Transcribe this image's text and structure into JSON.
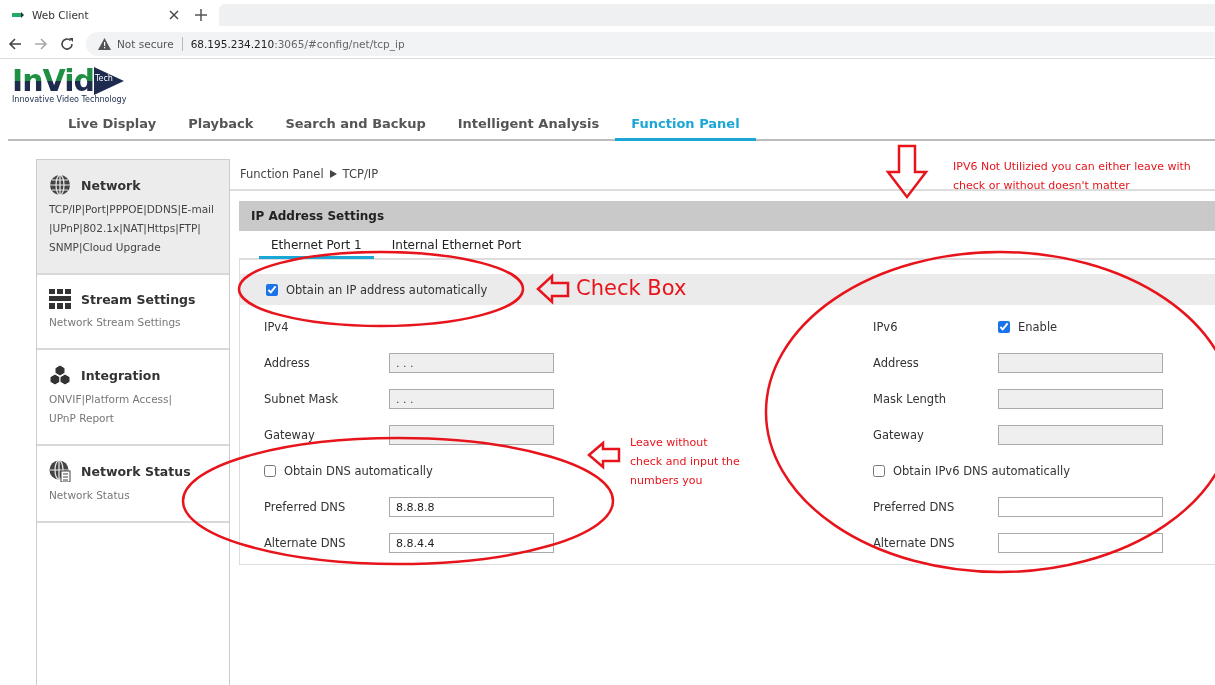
{
  "browser": {
    "tab_title": "Web Client",
    "warning": "Not secure",
    "host": "68.195.234.210",
    "path": ":3065/#config/net/tcp_ip"
  },
  "logo": {
    "name": "InVid",
    "badge": "Tech",
    "tagline": "Innovative Video Technology"
  },
  "nav": [
    {
      "label": "Live Display",
      "selected": false
    },
    {
      "label": "Playback",
      "selected": false
    },
    {
      "label": "Search and Backup",
      "selected": false
    },
    {
      "label": "Intelligent Analysis",
      "selected": false
    },
    {
      "label": "Function Panel",
      "selected": true
    }
  ],
  "sidebar": [
    {
      "title": "Network",
      "lines": [
        "TCP/IP|Port|PPPOE|DDNS|E-mail",
        "|UPnP|802.1x|NAT|Https|FTP|",
        "SNMP|Cloud Upgrade"
      ],
      "selected": true
    },
    {
      "title": "Stream Settings",
      "lines": [
        "Network Stream Settings"
      ],
      "selected": false
    },
    {
      "title": "Integration",
      "lines": [
        "ONVIF|Platform Access|",
        "UPnP Report"
      ],
      "selected": false
    },
    {
      "title": "Network Status",
      "lines": [
        "Network Status"
      ],
      "selected": false
    }
  ],
  "breadcrumb": [
    "Function Panel",
    "TCP/IP"
  ],
  "section_title": "IP Address Settings",
  "subtabs": [
    {
      "label": "Ethernet Port 1",
      "selected": true
    },
    {
      "label": "Internal Ethernet Port",
      "selected": false
    }
  ],
  "auto_ip": {
    "label": "Obtain an IP address automatically",
    "checked": true
  },
  "ipv4": {
    "heading": "IPv4",
    "fields": [
      {
        "label": "Address",
        "value": ". . .",
        "disabled": true
      },
      {
        "label": "Subnet Mask",
        "value": ". . .",
        "disabled": true
      },
      {
        "label": "Gateway",
        "disabled": true
      }
    ],
    "dns_auto": {
      "label": "Obtain DNS automatically",
      "checked": false
    },
    "dns": [
      {
        "label": "Preferred DNS",
        "value": "8.8.8.8",
        "disabled": false
      },
      {
        "label": "Alternate DNS",
        "value": "8.8.4.4",
        "disabled": false
      }
    ]
  },
  "ipv6": {
    "heading": "IPv6",
    "enable": {
      "label": "Enable",
      "checked": true
    },
    "fields": [
      {
        "label": "Address",
        "disabled": true
      },
      {
        "label": "Mask Length",
        "disabled": true
      },
      {
        "label": "Gateway",
        "disabled": true
      }
    ],
    "dns_auto": {
      "label": "Obtain IPv6 DNS automatically",
      "checked": false
    },
    "dns": [
      {
        "label": "Preferred DNS",
        "disabled": false
      },
      {
        "label": "Alternate DNS",
        "disabled": false
      }
    ]
  },
  "annotations": [
    "IPV6 Not Utilizied you can either leave with check or without doesn't matter",
    "Check Box",
    "Leave without check and input the numbers you"
  ]
}
